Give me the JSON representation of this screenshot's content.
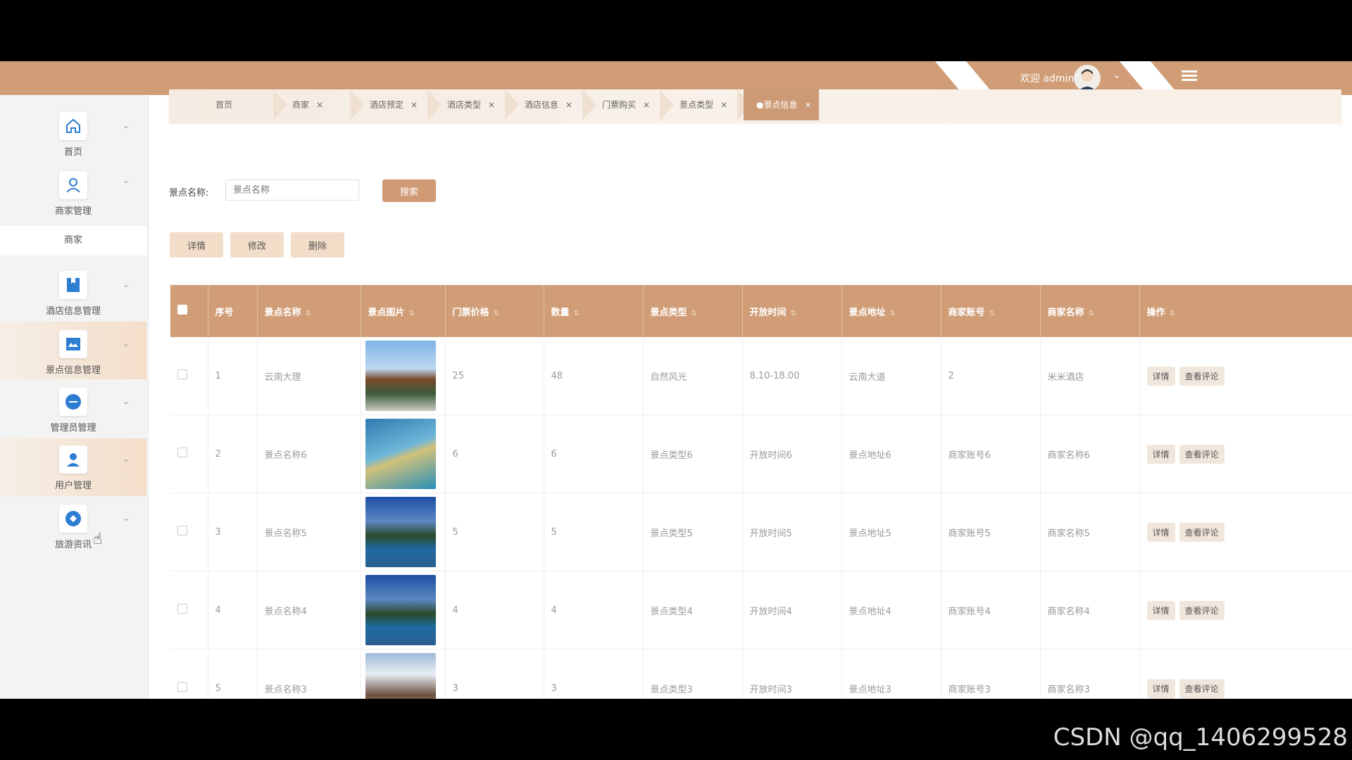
{
  "header": {
    "welcome": "欢迎 admin",
    "accent_color": "#d09d77"
  },
  "sidebar": {
    "items": [
      {
        "label": "首页",
        "icon": "home-icon"
      },
      {
        "label": "商家管理",
        "icon": "user-icon"
      },
      {
        "label": "酒店信息管理",
        "icon": "bookmark-icon"
      },
      {
        "label": "景点信息管理",
        "icon": "picture-icon"
      },
      {
        "label": "管理员管理",
        "icon": "more-icon"
      },
      {
        "label": "用户管理",
        "icon": "person-icon"
      },
      {
        "label": "旅游资讯",
        "icon": "compass-icon"
      }
    ],
    "submenu_label": "商家"
  },
  "tabs": [
    {
      "label": "首页"
    },
    {
      "label": "商家"
    },
    {
      "label": "酒店预定"
    },
    {
      "label": "酒店类型"
    },
    {
      "label": "酒店信息"
    },
    {
      "label": "门票购买"
    },
    {
      "label": "景点类型"
    },
    {
      "label": "●景点信息"
    }
  ],
  "search": {
    "label": "景点名称:",
    "placeholder": "景点名称",
    "button": "搜索"
  },
  "actions": {
    "detail": "详情",
    "edit": "修改",
    "delete": "删除"
  },
  "table": {
    "headers": [
      "序号",
      "景点名称",
      "景点图片",
      "门票价格",
      "数量",
      "景点类型",
      "开放时间",
      "景点地址",
      "商家账号",
      "商家名称",
      "操作"
    ],
    "rows": [
      {
        "idx": "1",
        "name": "云南大理",
        "price": "25",
        "qty": "48",
        "type": "自然风光",
        "time": "8.10-18.00",
        "addr": "云南大道",
        "account": "2",
        "merchant": "米米酒店"
      },
      {
        "idx": "2",
        "name": "景点名称6",
        "price": "6",
        "qty": "6",
        "type": "景点类型6",
        "time": "开放时间6",
        "addr": "景点地址6",
        "account": "商家账号6",
        "merchant": "商家名称6"
      },
      {
        "idx": "3",
        "name": "景点名称5",
        "price": "5",
        "qty": "5",
        "type": "景点类型5",
        "time": "开放时间5",
        "addr": "景点地址5",
        "account": "商家账号5",
        "merchant": "商家名称5"
      },
      {
        "idx": "4",
        "name": "景点名称4",
        "price": "4",
        "qty": "4",
        "type": "景点类型4",
        "time": "开放时间4",
        "addr": "景点地址4",
        "account": "商家账号4",
        "merchant": "商家名称4"
      },
      {
        "idx": "5",
        "name": "景点名称3",
        "price": "3",
        "qty": "3",
        "type": "景点类型3",
        "time": "开放时间3",
        "addr": "景点地址3",
        "account": "商家账号3",
        "merchant": "商家名称3"
      }
    ],
    "row_buttons": {
      "detail": "详情",
      "comments": "查看评论"
    }
  },
  "watermark": "CSDN @qq_1406299528"
}
